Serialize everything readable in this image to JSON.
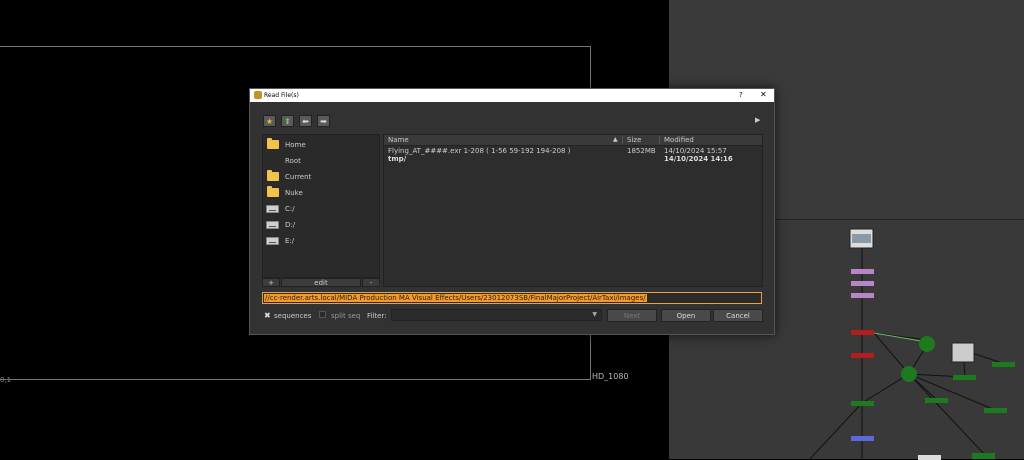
{
  "viewer": {
    "resolution_label": "HD_1080",
    "coord_label": "0,1"
  },
  "dialog": {
    "title": "Read File(s)",
    "help_label": "?",
    "close_label": "✕",
    "toolbar": {
      "favorite_glyph": "★",
      "up_glyph": "⬆",
      "back_glyph": "⬅",
      "forward_glyph": "➡",
      "more_glyph": "▶"
    },
    "sidebar": {
      "items": [
        {
          "label": "Home",
          "icon": "folder-icon"
        },
        {
          "label": "Root",
          "icon": "none"
        },
        {
          "label": "Current",
          "icon": "folder-icon"
        },
        {
          "label": "Nuke",
          "icon": "folder-icon"
        },
        {
          "label": "C:/",
          "icon": "drive-icon"
        },
        {
          "label": "D:/",
          "icon": "drive-icon"
        },
        {
          "label": "E:/",
          "icon": "drive-icon"
        }
      ],
      "add_label": "+",
      "edit_label": "edit",
      "remove_label": "-"
    },
    "file_list": {
      "columns": {
        "name": "Name",
        "sort_glyph": "▲",
        "size": "Size",
        "modified": "Modified"
      },
      "rows": [
        {
          "name": "Flying_AT_####.exr 1-208 ( 1-56 59-192 194-208 )",
          "size": "1852MB",
          "modified": "14/10/2024 15:57"
        },
        {
          "name": "tmp/",
          "size": "",
          "modified": "14/10/2024 14:16"
        }
      ]
    },
    "path": "//cc-render.arts.local/MIDA Production MA Visual Effects/Users/23012073SB/FinalMajorProject/AirTaxi/images/",
    "bottom": {
      "sequences_check_glyph": "✖",
      "sequences_label": "sequences",
      "split_seq_label": "split seq",
      "filter_label": "Filter:",
      "filter_value": "",
      "filter_arrow": "▼",
      "next_label": "Next",
      "open_label": "Open",
      "cancel_label": "Cancel"
    }
  }
}
